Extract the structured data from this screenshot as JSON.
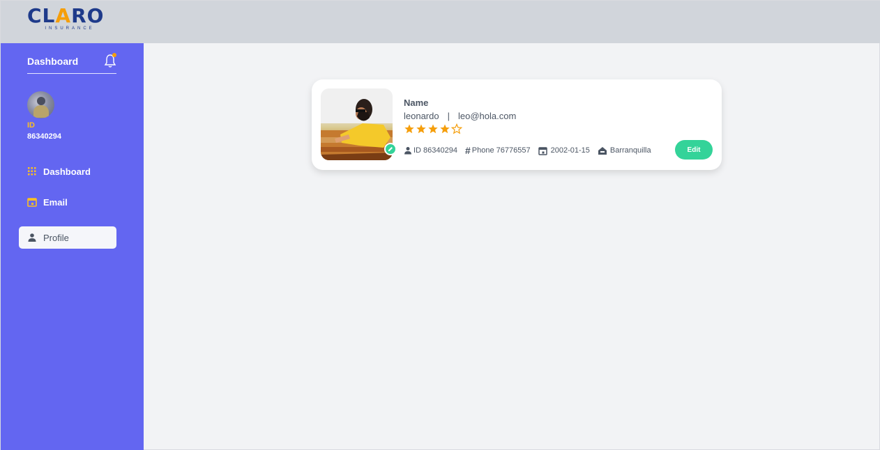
{
  "brand": {
    "logo_main_before": "CL",
    "logo_main_accent": "A",
    "logo_main_after": "RO",
    "logo_sub": "INSURANCE"
  },
  "sidebar": {
    "header_title": "Dashboard",
    "notification_dot": true,
    "user": {
      "id_label": "ID",
      "id_value": "86340294"
    },
    "items": [
      {
        "label": "Dashboard",
        "icon": "grid-icon",
        "active": false
      },
      {
        "label": "Email",
        "icon": "calendar-icon",
        "active": false
      },
      {
        "label": "Profile",
        "icon": "person-icon",
        "active": true
      }
    ]
  },
  "profile_card": {
    "name_label": "Name",
    "username": "leonardo",
    "separator": "|",
    "email": "leo@hola.com",
    "rating": {
      "value": 4,
      "max": 5
    },
    "meta": {
      "id": "ID 86340294",
      "phone": "Phone 76776557",
      "date": "2002-01-15",
      "city": "Barranquilla"
    },
    "edit_label": "Edit"
  },
  "colors": {
    "sidebar_bg": "#6366f1",
    "accent_orange": "#f59e0b",
    "success_green": "#34d399",
    "topbar_bg": "#d1d5db"
  }
}
